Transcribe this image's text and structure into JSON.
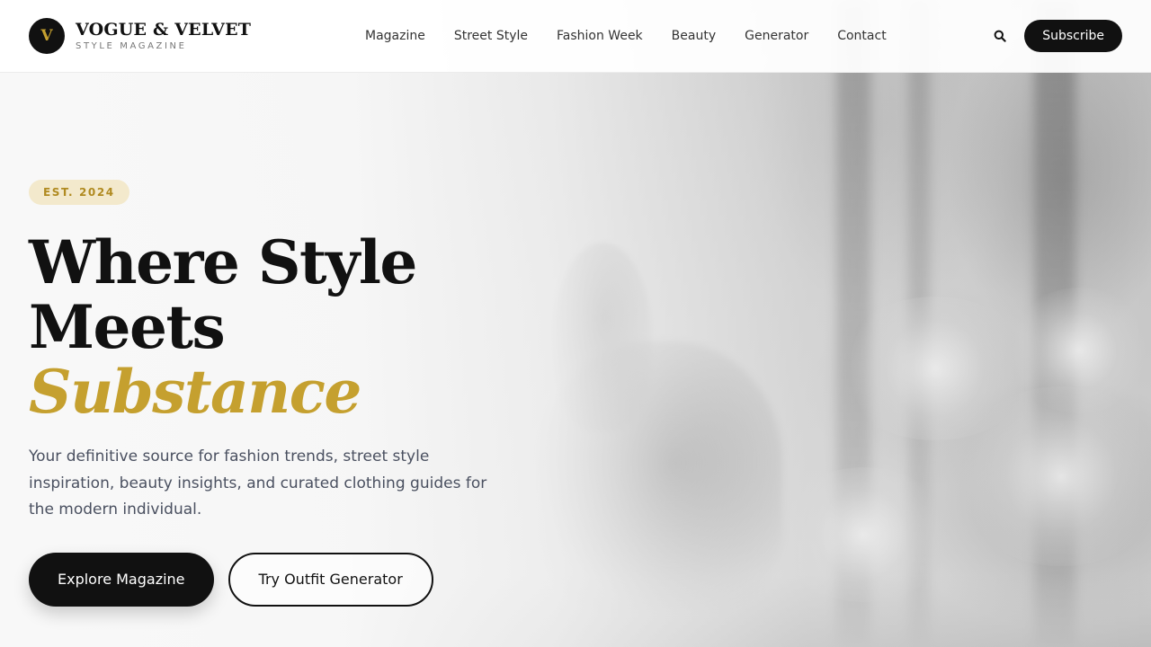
{
  "brand": {
    "logo_letter": "V",
    "name": "VOGUE & VELVET",
    "tagline": "STYLE MAGAZINE"
  },
  "nav": {
    "items": [
      {
        "label": "Magazine"
      },
      {
        "label": "Street Style"
      },
      {
        "label": "Fashion Week"
      },
      {
        "label": "Beauty"
      },
      {
        "label": "Generator"
      },
      {
        "label": "Contact"
      }
    ]
  },
  "header_actions": {
    "search_icon": "search-icon",
    "subscribe_label": "Subscribe"
  },
  "hero": {
    "badge": "EST. 2024",
    "headline_line1": "Where Style",
    "headline_line2_plain": "Meets",
    "headline_line2_accent": "Substance",
    "lede": "Your definitive source for fashion trends, street style inspiration, beauty insights, and curated clothing guides for the modern individual.",
    "primary_cta": "Explore Magazine",
    "secondary_cta": "Try Outfit Generator"
  },
  "colors": {
    "ink": "#111111",
    "gold": "#c5a02f",
    "badge_bg": "#f3e9cc",
    "muted_text": "#4a5060"
  }
}
